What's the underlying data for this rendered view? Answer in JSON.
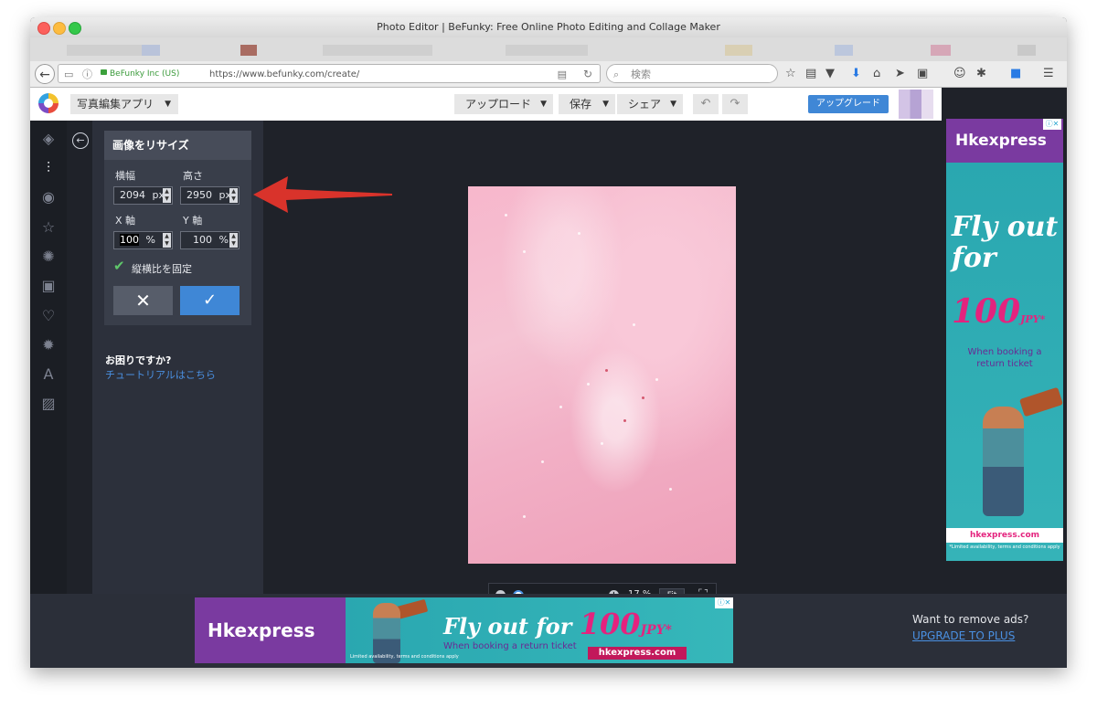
{
  "window": {
    "title": "Photo Editor | BeFunky: Free Online Photo Editing and Collage Maker"
  },
  "browser": {
    "identity": "BeFunky Inc (US)",
    "url": "https://www.befunky.com/create/",
    "search_placeholder": "検索"
  },
  "header": {
    "app_select": "写真編集アプリ",
    "upload": "アップロード",
    "save": "保存",
    "share": "シェア",
    "upgrade": "アップグレード"
  },
  "resize": {
    "title": "画像をリサイズ",
    "width_label": "横幅",
    "height_label": "高さ",
    "width_value": "2094",
    "height_value": "2950",
    "unit_px": "px",
    "x_label": "X 軸",
    "y_label": "Y 軸",
    "x_value": "100",
    "y_value": "100",
    "unit_pct": "%",
    "lock_ratio_label": "縦横比を固定",
    "lock_ratio_checked": true
  },
  "help": {
    "question": "お困りですか?",
    "tutorial_link": "チュートリアルはこちら"
  },
  "zoom": {
    "value": "17 %",
    "fit": "Fit",
    "level": 0.17
  },
  "ad_side": {
    "brand": "Hkexpress",
    "headline": "Fly out for",
    "price": "100",
    "currency": "JPY*",
    "sub": "When booking a return ticket",
    "domain": "hkexpress.com",
    "disclaimer": "*Limited availability, terms and conditions apply"
  },
  "ad_bottom": {
    "brand": "Hkexpress",
    "headline": "Fly out for",
    "price": "100",
    "currency": "JPY*",
    "sub": "When booking a return ticket",
    "domain": "hkexpress.com",
    "disclaimer": "Limited availability, terms and conditions apply"
  },
  "remove_ads": {
    "question": "Want to remove ads?",
    "link": "UPGRADE TO PLUS"
  },
  "colors": {
    "accent": "#3f87d6",
    "panel": "#2c303b",
    "annotation_arrow": "#d9332b"
  }
}
